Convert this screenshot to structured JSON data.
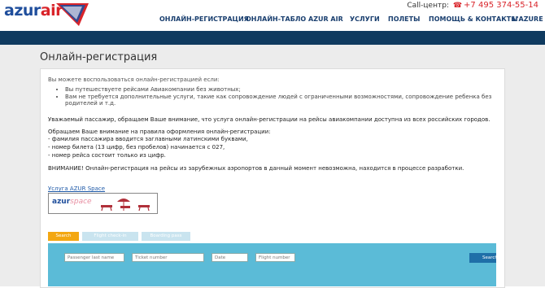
{
  "header": {
    "logo_text_azur": "azur",
    "logo_text_air": "air",
    "callcenter_label": "Call-центр:",
    "phone": "+7 495 374-55-14"
  },
  "nav": [
    "ОНЛАЙН-РЕГИСТРАЦИЯ",
    "ОНЛАЙН-ТАБЛО",
    "AZUR AIR",
    "УСЛУГИ",
    "ПОЛЕТЫ",
    "ПОМОЩЬ & КОНТАКТЫ",
    "L'AZURE"
  ],
  "page_title": "Онлайн-регистрация",
  "card": {
    "intro": "Вы можете воспользоваться онлайн-регистрацией если:",
    "conditions": [
      "Вы путешествуете рейсами Авиакомпании без животных;",
      "Вам не требуется дополнительные услуги, такие как сопровождение людей с ограниченными возможностями, сопровождение ребенка без родителей и т.д."
    ],
    "notice": "Уважаемый пассажир, обращаем Ваше внимание, что услуга онлайн-регистрации на рейсы авиакомпании доступна из всех российских городов.",
    "rules_title": "Обращаем Ваше внимание на правила оформления онлайн-регистрации:",
    "rules": [
      "- фамилия пассажира вводится заглавными латинскими буквами,",
      "- номер билета (13 цифр, без пробелов) начинается с 027,",
      "- номер рейса состоит только из цифр."
    ],
    "warning": "ВНИМАНИЕ! Онлайн-регистрация на рейсы из зарубежных аэропортов в данный момент невозможна, находится в процессе разработки.",
    "service_link": "Услуга AZUR Space",
    "banner_azur": "azur",
    "banner_space": "space"
  },
  "tabs": [
    "Search",
    "Flight check-in",
    "Boarding pass"
  ],
  "form": {
    "last_name_placeholder": "Passenger last name",
    "ticket_placeholder": "Ticket number",
    "date_placeholder": "Date",
    "flight_placeholder": "Flight number",
    "search_label": "Search"
  },
  "colors": {
    "brand_blue": "#1f4e9c",
    "brand_red": "#d9242a",
    "topbar": "#0f3a5f",
    "panel": "#5bbbd7",
    "tab_active": "#f3a712"
  }
}
